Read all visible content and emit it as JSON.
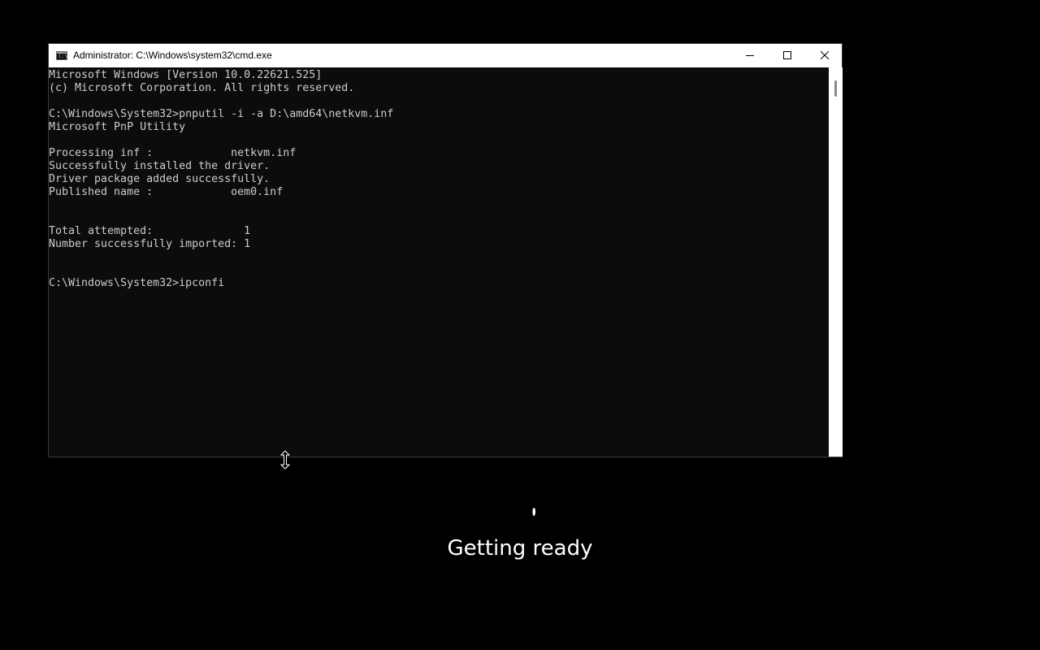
{
  "window": {
    "title": "Administrator: C:\\Windows\\system32\\cmd.exe",
    "app_icon_glyph": "C:\\",
    "controls": {
      "minimize_icon": "minimize-icon",
      "maximize_icon": "maximize-icon",
      "close_icon": "close-icon"
    }
  },
  "console": {
    "lines": [
      "Microsoft Windows [Version 10.0.22621.525]",
      "(c) Microsoft Corporation. All rights reserved.",
      "",
      "C:\\Windows\\System32>pnputil -i -a D:\\amd64\\netkvm.inf",
      "Microsoft PnP Utility",
      "",
      "Processing inf :            netkvm.inf",
      "Successfully installed the driver.",
      "Driver package added successfully.",
      "Published name :            oem0.inf",
      "",
      "",
      "Total attempted:              1",
      "Number successfully imported: 1",
      "",
      "",
      "C:\\Windows\\System32>ipconfi"
    ],
    "text_color": "#cccccc",
    "background_color": "#0c0c0c"
  },
  "overlay": {
    "status": "Getting ready",
    "spinner_icon": "loading-spinner-icon"
  },
  "cursor": {
    "icon": "vertical-resize-cursor-icon"
  }
}
